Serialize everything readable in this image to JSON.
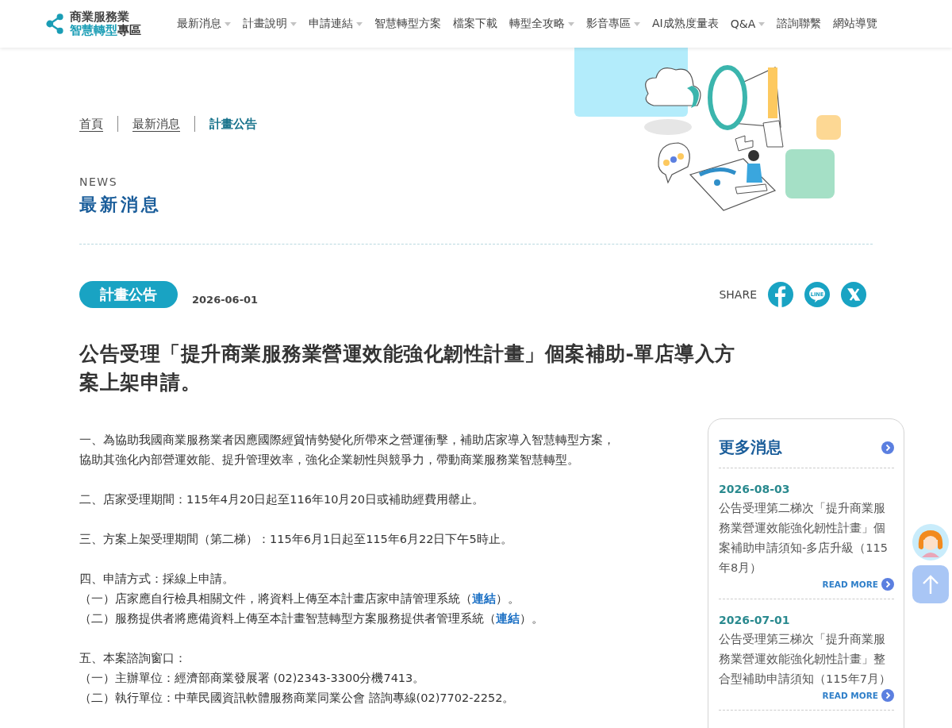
{
  "header": {
    "logo": {
      "line1": "商業服務業",
      "line2_accent": "智慧轉型",
      "line2_rest": "專區"
    },
    "nav": [
      {
        "label": "最新消息",
        "dropdown": true
      },
      {
        "label": "計畫說明",
        "dropdown": true
      },
      {
        "label": "申請連結",
        "dropdown": true
      },
      {
        "label": "智慧轉型方案",
        "dropdown": false
      },
      {
        "label": "檔案下載",
        "dropdown": false
      },
      {
        "label": "轉型全攻略",
        "dropdown": true
      },
      {
        "label": "影音專區",
        "dropdown": true
      },
      {
        "label": "AI成熟度量表",
        "dropdown": false
      },
      {
        "label": "Q&A",
        "dropdown": true
      },
      {
        "label": "諮詢聯繫",
        "dropdown": false
      },
      {
        "label": "網站導覽",
        "dropdown": false
      }
    ]
  },
  "breadcrumb": [
    {
      "label": "首頁",
      "current": false
    },
    {
      "label": "最新消息",
      "current": false
    },
    {
      "label": "計畫公告",
      "current": true
    }
  ],
  "section": {
    "eyebrow": "NEWS",
    "title": "最新消息"
  },
  "article": {
    "tag": "計畫公告",
    "date": "2026-06-01",
    "share_label": "SHARE",
    "share": [
      {
        "kind": "facebook"
      },
      {
        "kind": "line",
        "text": "LINE"
      },
      {
        "kind": "x"
      }
    ],
    "title": "公告受理「提升商業服務業營運效能強化韌性計畫」個案補助-單店導入方案上架申請。",
    "paragraphs": [
      [
        {
          "text": "一、為協助我國商業服務業者因應國際經貿情勢變化所帶來之營運衝擊，補助店家導入智慧轉型方案，"
        },
        {
          "text": "協助其強化內部營運效能、提升管理效率，強化企業韌性與競爭力，帶動商業服務業智慧轉型。"
        }
      ],
      [
        {
          "text": "二、店家受理期間：115年4月20日起至116年10月20日或補助經費用罄止。"
        }
      ],
      [
        {
          "text": "三、方案上架受理期間（第二梯）：115年6月1日起至115年6月22日下午5時止。"
        }
      ],
      [
        {
          "text": "四、申請方式：採線上申請。"
        },
        {
          "text": "（一）店家應自行檢具相關文件，將資料上傳至本計畫店家申請管理系統（",
          "link": "連結",
          "after": "）。"
        },
        {
          "text": "（二）服務提供者將應備資料上傳至本計畫智慧轉型方案服務提供者管理系統（",
          "link": "連結",
          "after": "）。"
        }
      ],
      [
        {
          "text": "五、本案諮詢窗口："
        },
        {
          "text": "（一）主辦單位：經濟部商業發展署 (02)2343-3300分機7413。"
        },
        {
          "text": "（二）執行單位：中華民國資訊軟體服務商業同業公會 諮詢專線(02)7702-2252。"
        }
      ]
    ]
  },
  "sidebar": {
    "title": "更多消息",
    "items": [
      {
        "date": "2026-08-03",
        "title": "公告受理第二梯次「提升商業服務業營運效能強化韌性計畫」個案補助申請須知-多店升級（115年8月）",
        "more": "READ MORE"
      },
      {
        "date": "2026-07-01",
        "title": "公告受理第三梯次「提升商業服務業營運效能強化韌性計畫」整合型補助申請須知（115年7月）",
        "more": "READ MORE"
      }
    ]
  }
}
